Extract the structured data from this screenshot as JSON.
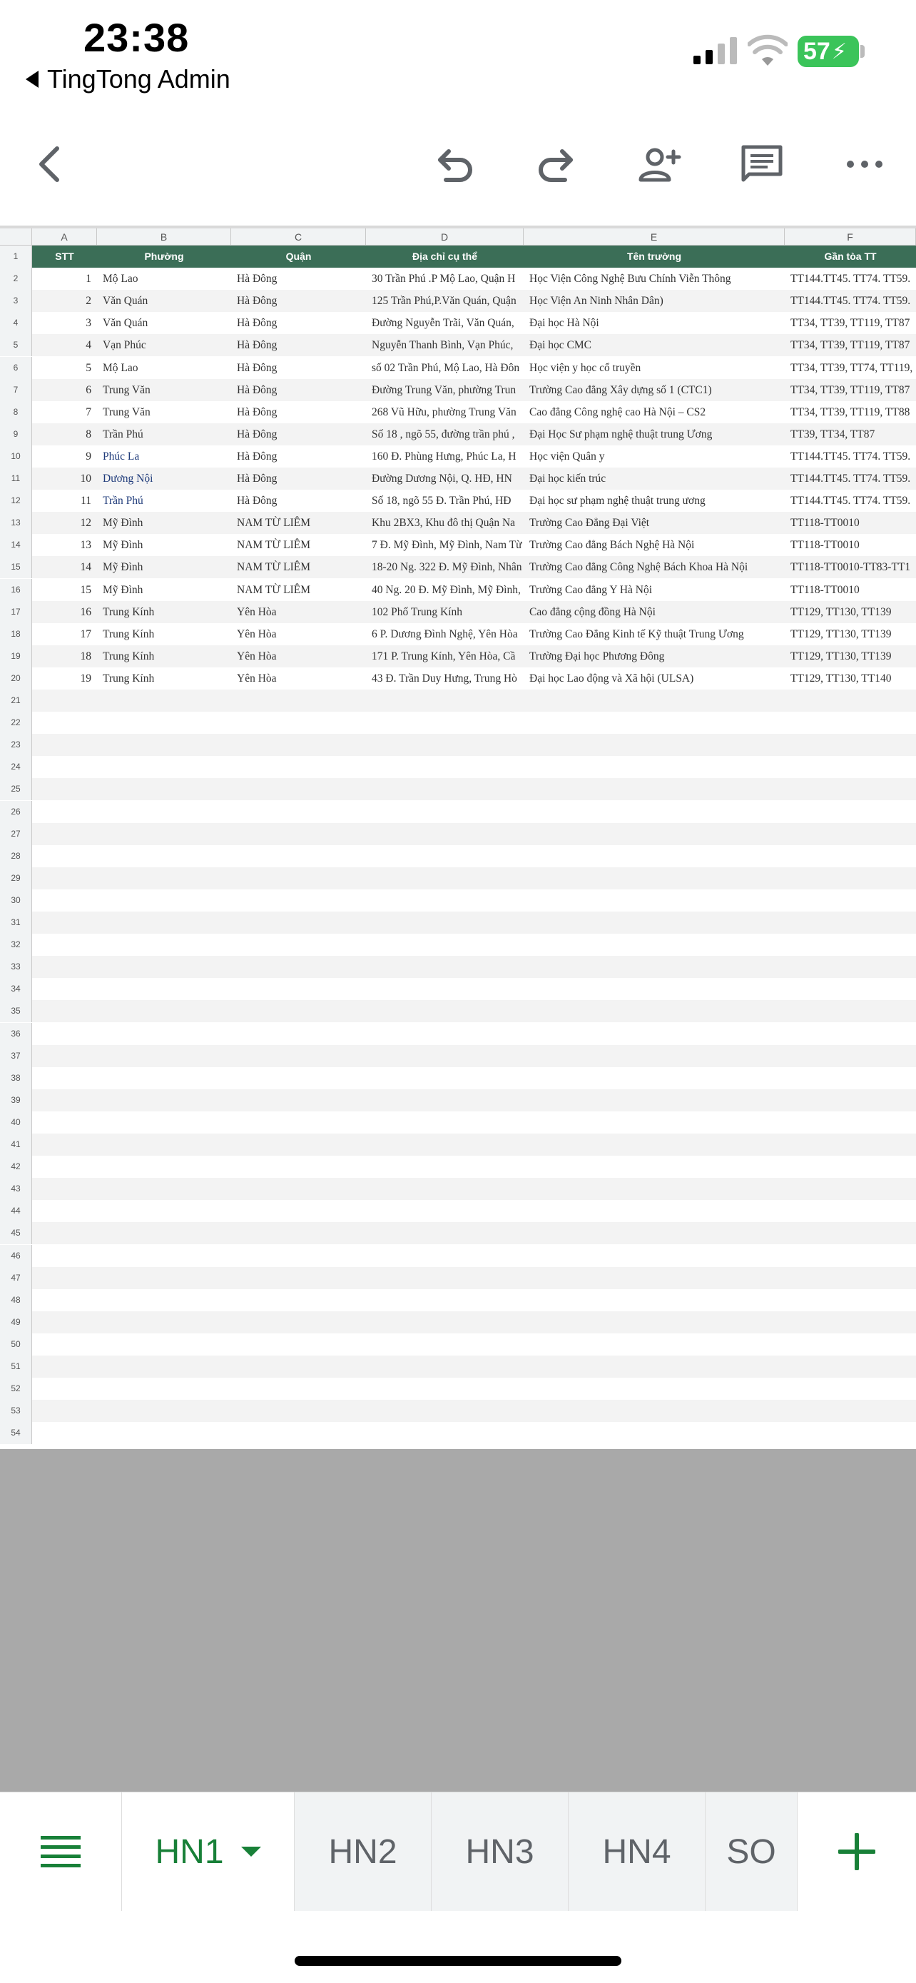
{
  "status_bar": {
    "time": "23:38",
    "back_app": "TingTong  Admin",
    "battery": "57"
  },
  "toolbar": {
    "back_icon": "chevron-left-icon",
    "undo_icon": "undo-icon",
    "redo_icon": "redo-icon",
    "share_icon": "add-person-icon",
    "comment_icon": "comment-icon",
    "more_icon": "more-horizontal-icon"
  },
  "sheet": {
    "column_letters": [
      "A",
      "B",
      "C",
      "D",
      "E",
      "F"
    ],
    "header": [
      "STT",
      "Phường",
      "Quận",
      "Địa chỉ cụ thể",
      "Tên trường",
      "Gần tòa TT"
    ],
    "rows": [
      [
        "1",
        "Mộ Lao",
        "Hà Đông",
        "30 Trần Phú .P Mộ Lao, Quận H",
        "Học Viện Công Nghệ Bưu Chính Viễn Thông",
        "TT144.TT45. TT74. TT59."
      ],
      [
        "2",
        "Văn Quán",
        "Hà Đông",
        "125 Trần Phú,P.Văn Quán, Quận",
        "Học Viện An Ninh Nhân Dân)",
        "TT144.TT45. TT74. TT59."
      ],
      [
        "3",
        "Văn Quán",
        "Hà Đông",
        "Đường Nguyễn Trãi, Văn Quán,",
        "Đại học Hà Nội",
        "TT34, TT39, TT119, TT87"
      ],
      [
        "4",
        "Vạn Phúc",
        "Hà Đông",
        "Nguyễn Thanh Bình, Vạn Phúc,",
        "Đại học CMC",
        "TT34, TT39, TT119, TT87"
      ],
      [
        "5",
        "Mộ Lao",
        "Hà Đông",
        "số 02 Trần Phú, Mộ Lao, Hà Đôn",
        "Học viện y học cổ truyền",
        "TT34, TT39, TT74, TT119,"
      ],
      [
        "6",
        "Trung Văn",
        "Hà Đông",
        "Đường Trung Văn, phường Trun",
        "Trường Cao đẳng Xây dựng số 1 (CTC1)",
        "TT34, TT39, TT119, TT87"
      ],
      [
        "7",
        "Trung Văn",
        "Hà Đông",
        "268 Vũ Hữu, phường Trung Văn",
        "Cao đẳng Công nghệ cao Hà Nội – CS2",
        "TT34, TT39, TT119, TT88"
      ],
      [
        "8",
        "Trần Phú",
        "Hà Đông",
        "Số 18 , ngõ 55, đường trần phú ,",
        "Đại Học Sư phạm nghệ thuật trung Ương",
        "TT39, TT34, TT87"
      ],
      [
        "9",
        "Phúc La",
        "Hà Đông",
        "160 Đ. Phùng Hưng, Phúc La, H",
        "Học viện Quân y",
        "TT144.TT45. TT74. TT59."
      ],
      [
        "10",
        "Dương Nội",
        "Hà Đông",
        "Đường Dương Nội, Q. HĐ, HN",
        "Đại học kiến trúc",
        "TT144.TT45. TT74. TT59."
      ],
      [
        "11",
        "Trần Phú",
        "Hà Đông",
        "Số 18, ngõ 55 Đ. Trần Phú, HĐ",
        "Đại học sư phạm nghệ thuật trung ương",
        "TT144.TT45. TT74. TT59."
      ],
      [
        "12",
        "Mỹ Đình",
        "NAM TỪ LIÊM",
        "Khu 2BX3, Khu đô thị Quận Na",
        "Trường Cao Đẳng Đại Việt",
        "TT118-TT0010"
      ],
      [
        "13",
        "Mỹ Đình",
        "NAM TỪ LIÊM",
        "7 Đ. Mỹ Đình, Mỹ Đình, Nam Từ L",
        "Trường Cao đẳng Bách Nghệ Hà Nội",
        "TT118-TT0010"
      ],
      [
        "14",
        "Mỹ Đình",
        "NAM TỪ LIÊM",
        "18-20 Ng. 322 Đ. Mỹ Đình, Nhân M",
        "Trường Cao đẳng Công Nghệ Bách Khoa Hà Nội",
        "TT118-TT0010-TT83-TT1"
      ],
      [
        "15",
        "Mỹ Đình",
        "NAM TỪ LIÊM",
        "40 Ng. 20 Đ. Mỹ Đình, Mỹ Đình, N",
        "Trường Cao đẳng Y Hà Nội",
        "TT118-TT0010"
      ],
      [
        "16",
        "Trung Kính",
        "Yên Hòa",
        "102 Phố Trung Kính",
        "Cao đẳng cộng đồng Hà Nội",
        "TT129, TT130, TT139"
      ],
      [
        "17",
        "Trung Kính",
        "Yên Hòa",
        "6 P. Dương Đình Nghệ, Yên Hòa",
        "Trường Cao Đẳng Kinh tế Kỹ thuật Trung Ương",
        "TT129, TT130, TT139"
      ],
      [
        "18",
        "Trung Kính",
        "Yên Hòa",
        "171 P. Trung Kính, Yên Hòa, Cầ",
        "Trường Đại học Phương Đông",
        "TT129, TT130, TT139"
      ],
      [
        "19",
        "Trung Kính",
        "Yên Hòa",
        "43 Đ. Trần Duy Hưng, Trung Hò",
        "Đại học Lao động và Xã hội (ULSA)",
        "TT129, TT130, TT140"
      ]
    ],
    "row_numbers": [
      "1",
      "2",
      "3",
      "4",
      "5",
      "6",
      "7",
      "8",
      "9",
      "10",
      "11",
      "12",
      "13",
      "14",
      "15",
      "16",
      "17",
      "18",
      "19",
      "20",
      "21",
      "22",
      "23",
      "24",
      "25",
      "26",
      "27",
      "28",
      "29",
      "30",
      "31",
      "32",
      "33",
      "34",
      "35",
      "36",
      "37",
      "38",
      "39",
      "40",
      "41",
      "42",
      "43",
      "44",
      "45",
      "46",
      "47",
      "48",
      "49",
      "50",
      "51",
      "52",
      "53",
      "54"
    ]
  },
  "tabs": {
    "menu_icon": "sheet-list-icon",
    "items": [
      "HN1",
      "HN2",
      "HN3",
      "HN4",
      "SO"
    ],
    "active": "HN1",
    "add_icon": "plus-icon"
  },
  "colors": {
    "header_green": "#3b6e57",
    "accent": "#188038"
  }
}
